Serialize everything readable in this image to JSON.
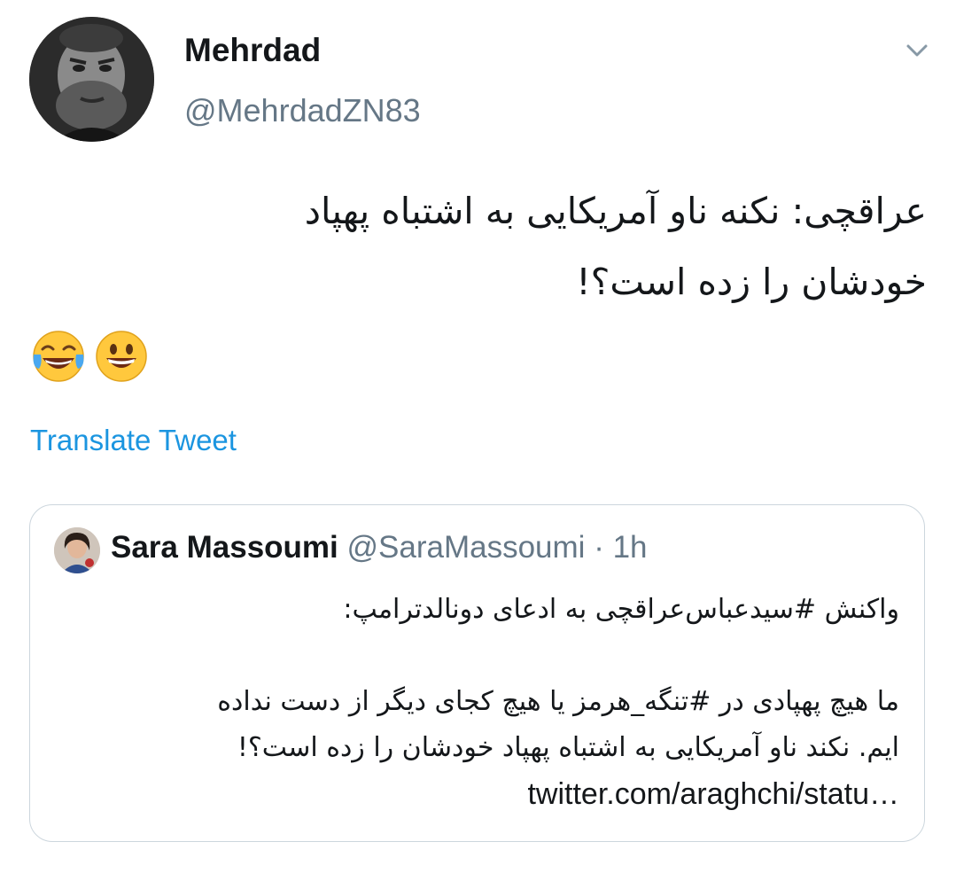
{
  "tweet": {
    "author_name": "Mehrdad",
    "author_handle": "@MehrdadZN83",
    "text_line1": "عراقچی: نکنه ناو آمریکایی به اشتباه پهپاد",
    "text_line2": "خودشان را زده است؟!",
    "emojis": [
      "face-with-tears-of-joy-icon",
      "grinning-face-icon"
    ],
    "translate_label": "Translate Tweet"
  },
  "quote": {
    "author_name": "Sara Massoumi",
    "author_handle": "@SaraMassoumi",
    "separator": "·",
    "time": "1h",
    "line1": "واکنش #سیدعباس‌عراقچی به ادعای دونالدترامپ:",
    "line2": "",
    "line3": "ما هیچ پهپادی در #تنگه_هرمز یا هیچ کجای دیگر از دست نداده",
    "line4": "ایم. نکند ناو آمریکایی به اشتباه پهپاد خودشان را زده است؟!",
    "line5": "twitter.com/araghchi/statu…"
  },
  "colors": {
    "text": "#14171a",
    "secondary": "#657786",
    "link": "#1b95e0",
    "border": "#ccd6dd"
  }
}
